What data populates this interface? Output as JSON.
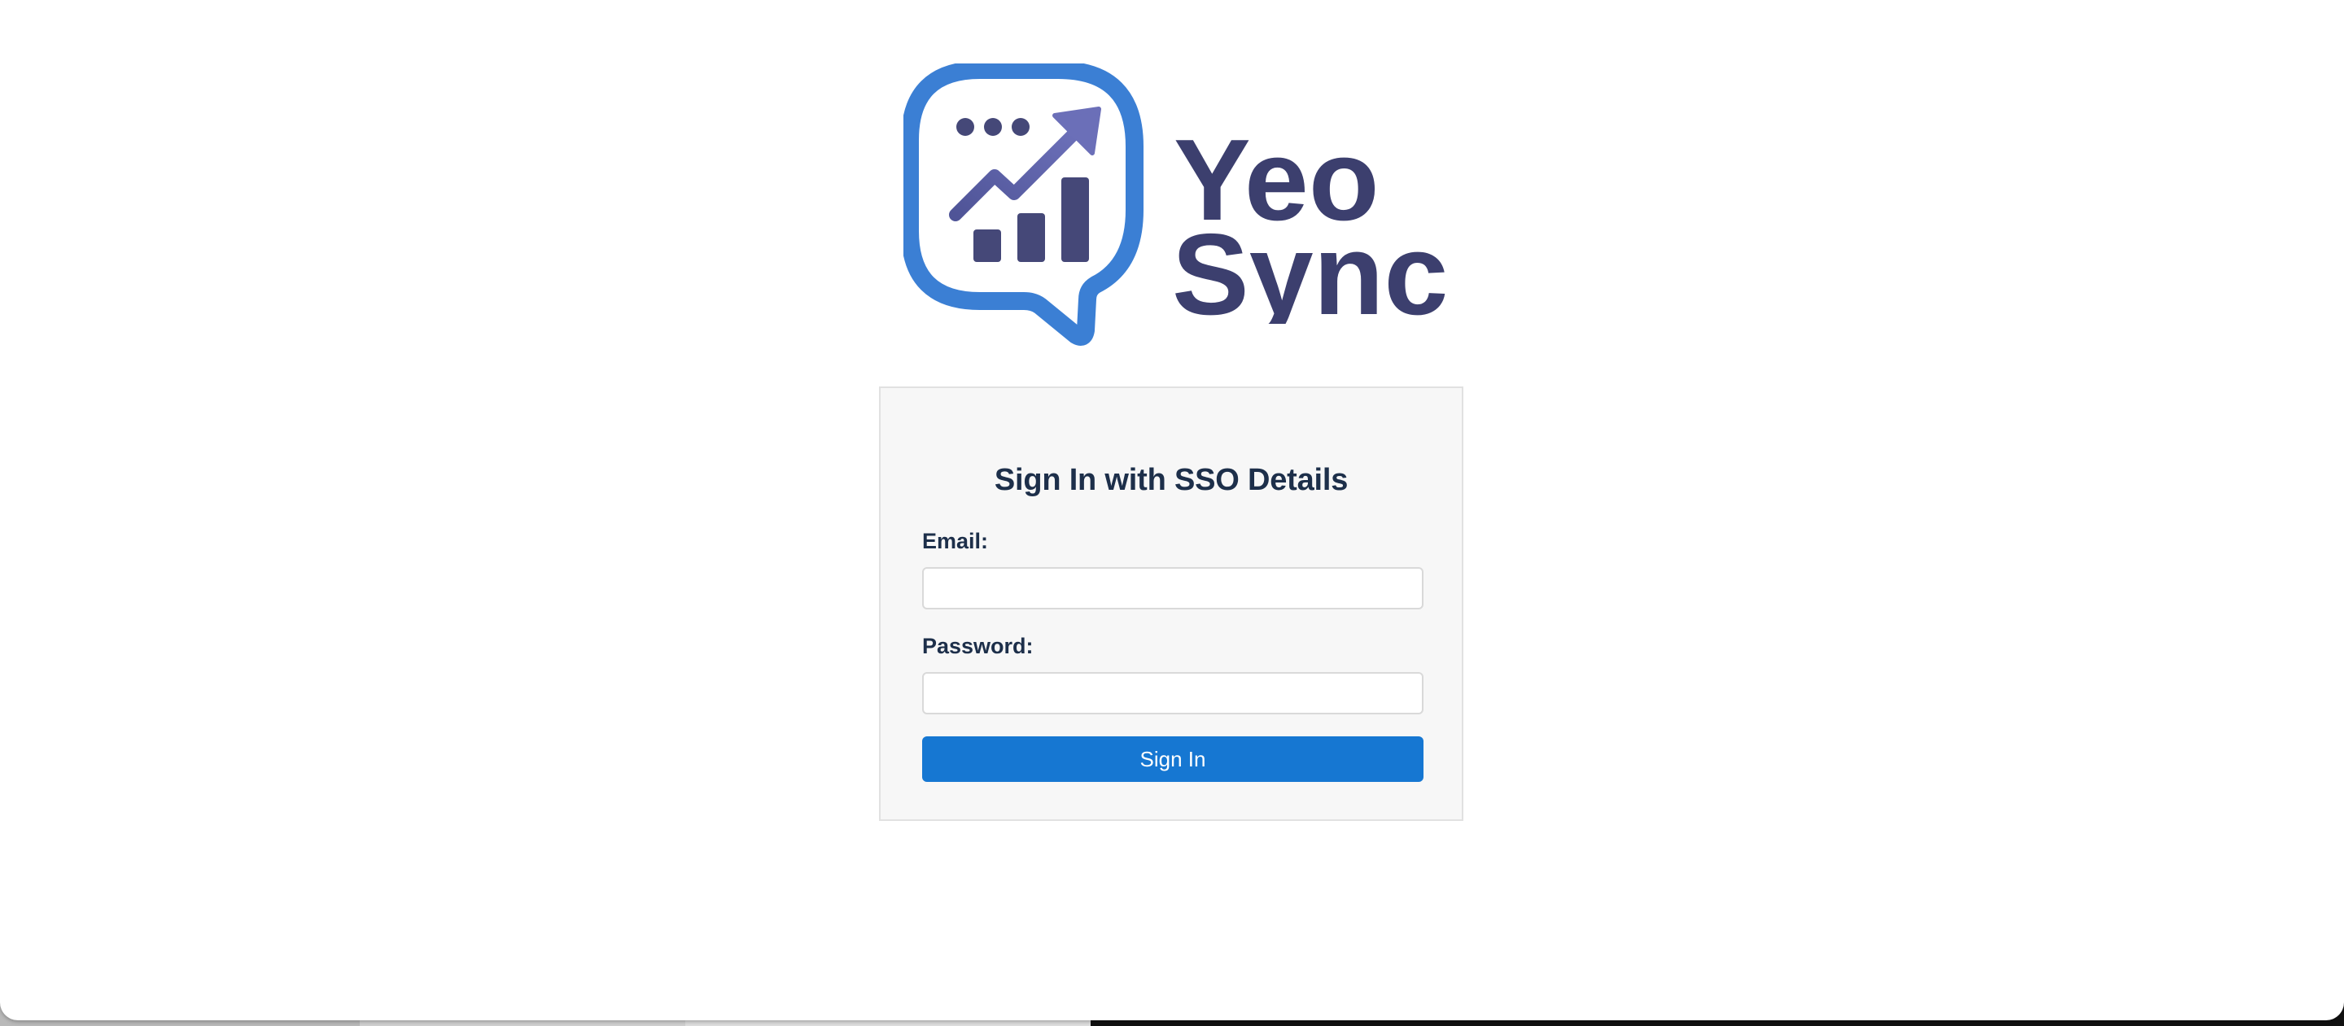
{
  "brand": {
    "name_line1": "Yeo",
    "name_line2": "Sync",
    "icon": "chat-bubble-chart-icon",
    "colors": {
      "bubble": "#3b7fd4",
      "text": "#3c3f6e",
      "bars": "#454878",
      "arrow": "#6b6fb8"
    }
  },
  "login": {
    "title": "Sign In with SSO Details",
    "email_label": "Email:",
    "email_value": "",
    "password_label": "Password:",
    "password_value": "",
    "submit_label": "Sign In",
    "accent_color": "#1677d2"
  }
}
